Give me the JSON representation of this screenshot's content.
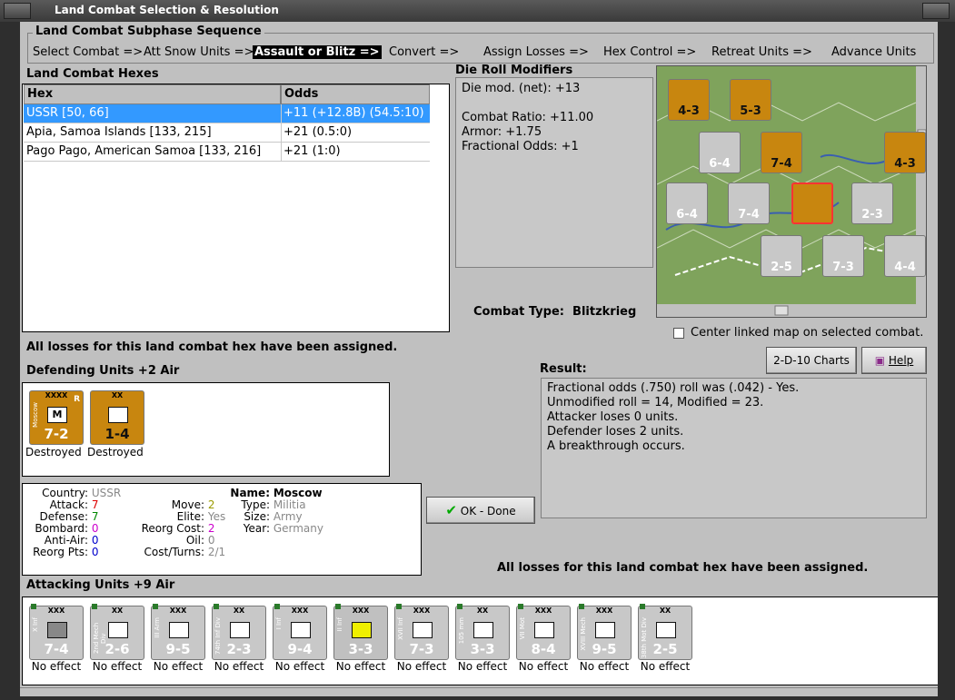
{
  "window": {
    "title": "Land Combat Selection & Resolution"
  },
  "sequence": {
    "title": "Land Combat Subphase Sequence",
    "steps": [
      "Select Combat =>",
      "Att Snow Units =>",
      "Assault or Blitz =>",
      "Convert =>",
      "Assign Losses =>",
      "Hex Control =>",
      "Retreat Units =>",
      "Advance Units"
    ]
  },
  "hexes": {
    "title": "Land Combat Hexes",
    "col_hex": "Hex",
    "col_odds": "Odds",
    "rows": [
      {
        "hex": "USSR [50, 66]",
        "odds": "+11 (+12.8B) (54.5:10)"
      },
      {
        "hex": "Apia, Samoa Islands [133, 215]",
        "odds": "+21 (0.5:0)"
      },
      {
        "hex": "Pago Pago, American Samoa [133, 216]",
        "odds": "+21 (1:0)"
      }
    ]
  },
  "modifiers": {
    "title": "Die Roll Modifiers",
    "lines": [
      "Die mod. (net): +13",
      "",
      "Combat Ratio: +11.00",
      "Armor: +1.75",
      "Fractional Odds: +1"
    ]
  },
  "combat_type": {
    "label": "Combat Type:",
    "value": "Blitzkrieg"
  },
  "center_map": "Center linked map on selected combat.",
  "losses_msg": "All losses for this land combat hex have been assigned.",
  "buttons": {
    "charts": "2-D-10 Charts",
    "help": "Help",
    "ok": "OK - Done"
  },
  "defending": {
    "title": "Defending Units +2 Air",
    "units": [
      {
        "top": "XXXX",
        "side": "Moscow",
        "value": "7-2",
        "status": "Destroyed",
        "letter": "M",
        "r": "R"
      },
      {
        "top": "XX",
        "side": "",
        "value": "1-4",
        "status": "Destroyed",
        "letter": "",
        "r": ""
      }
    ]
  },
  "result": {
    "title": "Result:",
    "lines": [
      "Fractional odds (.750) roll was (.042)  - Yes.",
      "Unmodified roll = 14, Modified = 23.",
      "Attacker loses 0 units.",
      "Defender loses 2 units.",
      "A breakthrough occurs."
    ]
  },
  "unit_info": {
    "country_l": "Country:",
    "country": "USSR",
    "attack_l": "Attack:",
    "attack": "7",
    "defense_l": "Defense:",
    "defense": "7",
    "bombard_l": "Bombard:",
    "bombard": "0",
    "antiair_l": "Anti-Air:",
    "antiair": "0",
    "reorg_l": "Reorg Pts:",
    "reorg": "0",
    "move_l": "Move:",
    "move": "2",
    "elite_l": "Elite:",
    "elite": "Yes",
    "reorgcost_l": "Reorg Cost:",
    "reorgcost": "2",
    "oil_l": "Oil:",
    "oil": "0",
    "costturns_l": "Cost/Turns:",
    "costturns": "2/1",
    "name_l": "Name:",
    "name": "Moscow",
    "type_l": "Type:",
    "type": "Militia",
    "size_l": "Size:",
    "size": "Army",
    "year_l": "Year:",
    "year": "Germany"
  },
  "attacking": {
    "title": "Attacking Units +9 Air",
    "units": [
      {
        "top": "XXX",
        "side": "X Inf",
        "value": "7-4",
        "status": "No effect",
        "sym": "grey"
      },
      {
        "top": "XX",
        "side": "2nd Mech Div",
        "value": "2-6",
        "status": "No effect",
        "sym": "white"
      },
      {
        "top": "XXX",
        "side": "III Arm",
        "value": "9-5",
        "status": "No effect",
        "sym": "white"
      },
      {
        "top": "XX",
        "side": "74th Inf Div",
        "value": "2-3",
        "status": "No effect",
        "sym": "white"
      },
      {
        "top": "XXX",
        "side": "I Inf",
        "value": "9-4",
        "status": "No effect",
        "sym": "white"
      },
      {
        "top": "XXX",
        "side": "II Inf",
        "value": "3-3",
        "status": "No effect",
        "sym": "yel"
      },
      {
        "top": "XXX",
        "side": "XVII Inf",
        "value": "7-3",
        "status": "No effect",
        "sym": "white"
      },
      {
        "top": "XX",
        "side": "105 mm",
        "value": "3-3",
        "status": "No effect",
        "sym": "white"
      },
      {
        "top": "XXX",
        "side": "VII Mot",
        "value": "8-4",
        "status": "No effect",
        "sym": "white"
      },
      {
        "top": "XXX",
        "side": "XVIII Mech",
        "value": "9-5",
        "status": "No effect",
        "sym": "white"
      },
      {
        "top": "XX",
        "side": "38th Mot Div",
        "value": "2-5",
        "status": "No effect",
        "sym": "white"
      }
    ]
  },
  "map_counters": [
    {
      "value": "4-3"
    },
    {
      "value": "5-3"
    },
    {
      "value": "6-4"
    },
    {
      "value": "7-4"
    },
    {
      "value": "4-3"
    },
    {
      "value": "6-4"
    },
    {
      "value": "7-4"
    },
    {
      "value": "2-3"
    },
    {
      "value": "2-5"
    },
    {
      "value": "7-3"
    },
    {
      "value": "4-4"
    }
  ]
}
